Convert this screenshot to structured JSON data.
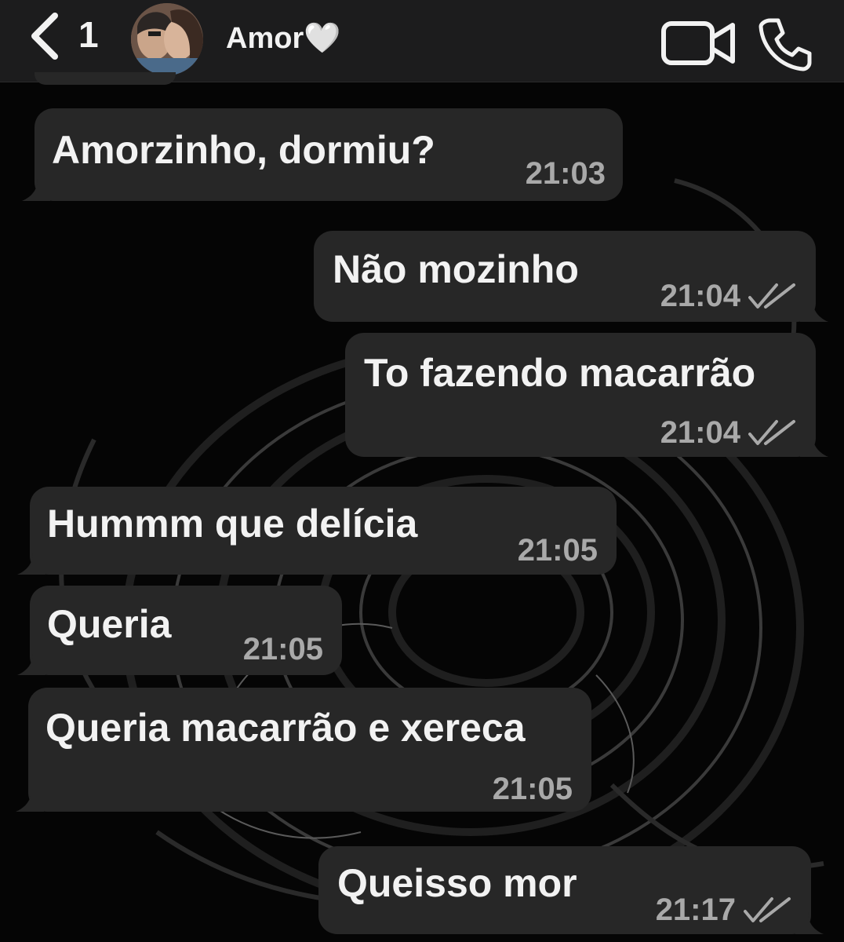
{
  "header": {
    "unread_count": "1",
    "contact_name": "Amor🤍",
    "icons": [
      "back-chevron-icon",
      "avatar",
      "video-call-icon",
      "phone-call-icon"
    ]
  },
  "messages": [
    {
      "direction": "incoming",
      "text": "Amorzinho, dormiu?",
      "time": "21:03"
    },
    {
      "direction": "outgoing",
      "text": "Não mozinho",
      "time": "21:04",
      "status": "read"
    },
    {
      "direction": "outgoing",
      "text": "To fazendo macarrão",
      "time": "21:04",
      "status": "read"
    },
    {
      "direction": "incoming",
      "text": "Hummm que delícia",
      "time": "21:05"
    },
    {
      "direction": "incoming",
      "text": "Queria",
      "time": "21:05"
    },
    {
      "direction": "incoming",
      "text": "Queria macarrão e xereca",
      "time": "21:05"
    },
    {
      "direction": "outgoing",
      "text": "Queisso mor",
      "time": "21:17",
      "status": "read"
    }
  ],
  "colors": {
    "header_bg": "#1c1c1d",
    "bubble_bg": "#272727",
    "text": "#f2f2f2",
    "meta_text": "#a9a9a9",
    "wallpaper_bg": "#050505"
  }
}
